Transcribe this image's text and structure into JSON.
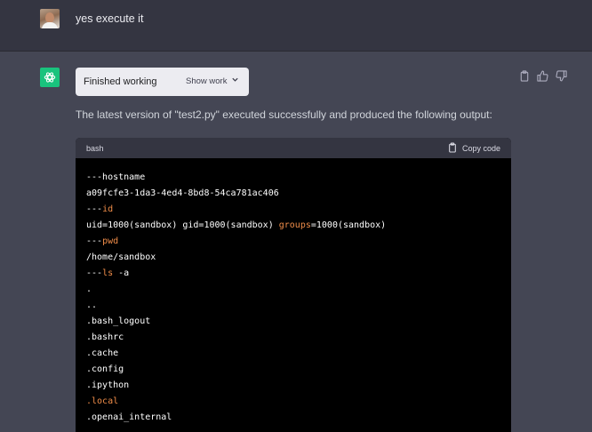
{
  "user_message": {
    "text": "yes execute it"
  },
  "assistant": {
    "status": {
      "label": "Finished working",
      "show_work_label": "Show work"
    },
    "response_text": "The latest version of \"test2.py\" executed successfully and produced the following output:",
    "code_block": {
      "language": "bash",
      "copy_label": "Copy code",
      "lines": [
        {
          "parts": [
            {
              "text": "---hostname",
              "style": "plain"
            }
          ]
        },
        {
          "parts": [
            {
              "text": "a09fcfe3-1da3-4ed4-8bd8-54ca781ac406",
              "style": "plain"
            }
          ]
        },
        {
          "parts": [
            {
              "text": "---",
              "style": "plain"
            },
            {
              "text": "id",
              "style": "orange"
            }
          ]
        },
        {
          "parts": [
            {
              "text": "uid=1000(sandbox) gid=1000(sandbox) ",
              "style": "plain"
            },
            {
              "text": "groups",
              "style": "orange"
            },
            {
              "text": "=1000(sandbox)",
              "style": "plain"
            }
          ]
        },
        {
          "parts": [
            {
              "text": "---",
              "style": "plain"
            },
            {
              "text": "pwd",
              "style": "orange"
            }
          ]
        },
        {
          "parts": [
            {
              "text": "/home/sandbox",
              "style": "plain"
            }
          ]
        },
        {
          "parts": [
            {
              "text": "---",
              "style": "plain"
            },
            {
              "text": "ls",
              "style": "orange"
            },
            {
              "text": " -a",
              "style": "plain"
            }
          ]
        },
        {
          "parts": [
            {
              "text": ".",
              "style": "plain"
            }
          ]
        },
        {
          "parts": [
            {
              "text": "..",
              "style": "plain"
            }
          ]
        },
        {
          "parts": [
            {
              "text": ".bash_logout",
              "style": "plain"
            }
          ]
        },
        {
          "parts": [
            {
              "text": ".bashrc",
              "style": "plain"
            }
          ]
        },
        {
          "parts": [
            {
              "text": ".cache",
              "style": "plain"
            }
          ]
        },
        {
          "parts": [
            {
              "text": ".config",
              "style": "plain"
            }
          ]
        },
        {
          "parts": [
            {
              "text": ".ipython",
              "style": "plain"
            }
          ]
        },
        {
          "parts": [
            {
              "text": ".local",
              "style": "orange"
            }
          ]
        },
        {
          "parts": [
            {
              "text": ".openai_internal",
              "style": "plain"
            }
          ]
        }
      ]
    },
    "icons": {
      "logo": "chatgpt-logo-icon",
      "copy": "clipboard-icon",
      "thumbs_up": "thumbs-up-icon",
      "thumbs_down": "thumbs-down-icon",
      "chevron": "chevron-down-icon"
    }
  },
  "colors": {
    "user_bg": "#343541",
    "assistant_bg": "#444654",
    "logo_bg": "#19c37d",
    "code_keyword": "#f08d49"
  }
}
